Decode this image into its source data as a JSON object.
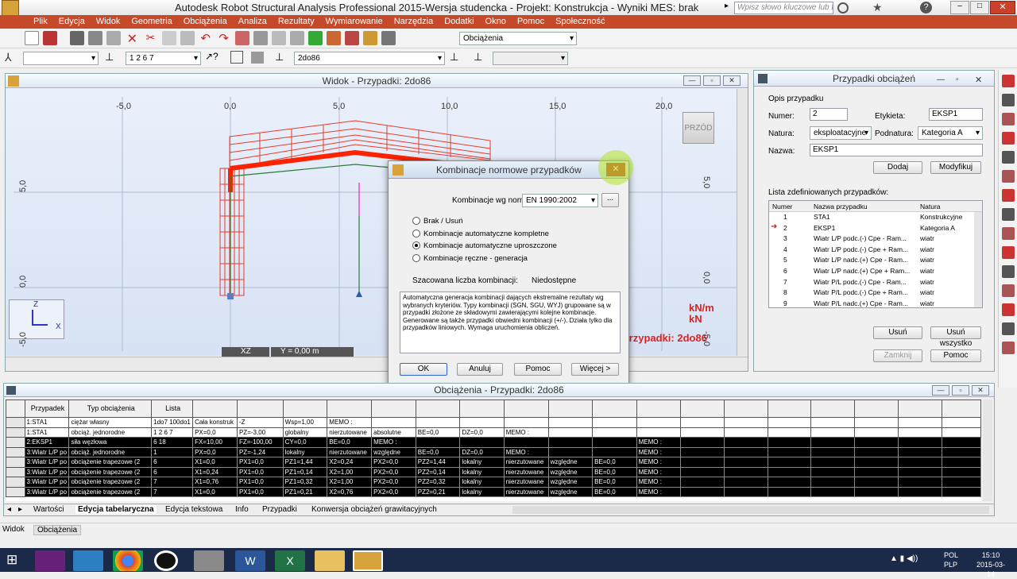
{
  "app": {
    "title": "Autodesk Robot Structural Analysis Professional 2015-Wersja studencka - Projekt: Konstrukcja - Wyniki MES: brak",
    "search_placeholder": "Wpisz słowo kluczowe lub frazę",
    "logo": "PRO"
  },
  "menu": [
    "Plik",
    "Edycja",
    "Widok",
    "Geometria",
    "Obciążenia",
    "Analiza",
    "Rezultaty",
    "Wymiarowanie",
    "Narzędzia",
    "Dodatki",
    "Okno",
    "Pomoc",
    "Społeczność"
  ],
  "toolbar": {
    "loads_combo": "Obciążenia",
    "list_value": "1 2 6 7",
    "case_value": "2do86"
  },
  "view": {
    "title": "Widok - Przypadki: 2do86",
    "badge": "PRZÓD",
    "ruler_top": [
      "-5,0",
      "0,0",
      "5,0",
      "10,0",
      "15,0",
      "20,0"
    ],
    "ruler_side": [
      "5,0",
      "0,0",
      "-5,0"
    ],
    "plane": "XZ",
    "coord": "Y = 0,00 m",
    "units1": "kN/m",
    "units2": "kN",
    "case_label": "Przypadki: 2do86",
    "axis_z": "Z",
    "axis_x": "X"
  },
  "dialog": {
    "title": "Kombinacje normowe przypadków",
    "norm_label": "Kombinacje wg normy:",
    "norm_value": "EN 1990:2002",
    "more_btn": "...",
    "options": [
      "Brak / Usuń",
      "Kombinacje automatyczne kompletne",
      "Kombinacje automatyczne uproszczone",
      "Kombinacje ręczne - generacja"
    ],
    "selected": 2,
    "estimate_label": "Szacowana liczba kombinacji:",
    "estimate_value": "Niedostępne",
    "description": "Automatyczna generacja kombinacji dających ekstremalne rezultaty wg wybranych kryteriów.  Typy kombinacji (SGN, SGU, WYJ) grupowane są w przypadki złożone ze składowymi zawierającymi kolejne kombinacje. Generowane są także przypadki obwiedni kombinacji (+/-). Działa tylko dla przypadków liniowych.  Wymaga uruchomienia obliczeń.",
    "ok": "OK",
    "cancel": "Anuluj",
    "help": "Pomoc",
    "more": "Więcej >"
  },
  "panel": {
    "title": "Przypadki obciążeń",
    "group_label": "Opis przypadku",
    "numer_label": "Numer:",
    "numer_value": "2",
    "etykieta_label": "Etykieta:",
    "etykieta_value": "EKSP1",
    "natura_label": "Natura:",
    "natura_value": "eksploatacyjne",
    "podnatura_label": "Podnatura:",
    "podnatura_value": "Kategoria A",
    "nazwa_label": "Nazwa:",
    "nazwa_value": "EKSP1",
    "add": "Dodaj",
    "modify": "Modyfikuj",
    "list_label": "Lista zdefiniowanych przypadków:",
    "cols": [
      "Numer",
      "Nazwa przypadku",
      "Natura"
    ],
    "rows": [
      [
        "1",
        "STA1",
        "Konstrukcyjne"
      ],
      [
        "2",
        "EKSP1",
        "Kategoria A"
      ],
      [
        "3",
        "Wiatr L/P podc.(-) Cpe - Ram...",
        "wiatr"
      ],
      [
        "4",
        "Wiatr L/P podc.(-) Cpe + Ram...",
        "wiatr"
      ],
      [
        "5",
        "Wiatr L/P nadc.(+) Cpe - Ram...",
        "wiatr"
      ],
      [
        "6",
        "Wiatr L/P nadc.(+) Cpe + Ram...",
        "wiatr"
      ],
      [
        "7",
        "Wiatr P/L podc.(-) Cpe - Ram...",
        "wiatr"
      ],
      [
        "8",
        "Wiatr P/L podc.(-) Cpe + Ram...",
        "wiatr"
      ],
      [
        "9",
        "Wiatr P/L nadc.(+) Cpe - Ram...",
        "wiatr"
      ]
    ],
    "remove": "Usuń",
    "remove_all": "Usuń wszystko",
    "close": "Zamknij",
    "help": "Pomoc"
  },
  "table": {
    "title": "Obciążenia - Przypadki: 2do86",
    "header": [
      "Przypadek",
      "Typ obciążenia",
      "Lista"
    ],
    "rows": [
      [
        "1:STA1",
        "ciężar własny",
        "1do7 100do1",
        "Cała konstruk",
        "-Z",
        "Wsp=1,00",
        "MEMO :",
        "",
        "",
        "",
        "",
        "",
        ""
      ],
      [
        "1:STA1",
        "obciąż. jednorodne",
        "1 2 6 7",
        "PX=0,0",
        "PZ=-3,00",
        "globalny",
        "nierzutowane",
        "absolutne",
        "BE=0,0",
        "DZ=0,0",
        "MEMO :",
        "",
        ""
      ],
      [
        "2:EKSP1",
        "siła węzłowa",
        "6 18",
        "FX=10,00",
        "FZ=-100,00",
        "CY=0,0",
        "BE=0,0",
        "MEMO :",
        "",
        "",
        "",
        "",
        ""
      ],
      [
        "3:Wiatr L/P po",
        "obciąż. jednorodne",
        "1",
        "PX=0,0",
        "PZ=-1,24",
        "lokalny",
        "nierzutowane",
        "względne",
        "BE=0,0",
        "DZ=0,0",
        "MEMO :",
        "",
        ""
      ],
      [
        "3:Wiatr L/P po",
        "obciążenie trapezowe (2",
        "6",
        "X1=0,0",
        "PX1=0,0",
        "PZ1=1,44",
        "X2=0,24",
        "PX2=0,0",
        "PZ2=1,44",
        "lokalny",
        "nierzutowane",
        "względne",
        "BE=0,0"
      ],
      [
        "3:Wiatr L/P po",
        "obciążenie trapezowe (2",
        "6",
        "X1=0,24",
        "PX1=0,0",
        "PZ1=0,14",
        "X2=1,00",
        "PX2=0,0",
        "PZ2=0,14",
        "lokalny",
        "nierzutowane",
        "względne",
        "BE=0,0"
      ],
      [
        "3:Wiatr L/P po",
        "obciążenie trapezowe (2",
        "7",
        "X1=0,76",
        "PX1=0,0",
        "PZ1=0,32",
        "X2=1,00",
        "PX2=0,0",
        "PZ2=0,32",
        "lokalny",
        "nierzutowane",
        "względne",
        "BE=0,0"
      ],
      [
        "3:Wiatr L/P po",
        "obciążenie trapezowe (2",
        "7",
        "X1=0,0",
        "PX1=0,0",
        "PZ1=0,21",
        "X2=0,76",
        "PX2=0,0",
        "PZ2=0,21",
        "lokalny",
        "nierzutowane",
        "względne",
        "BE=0,0"
      ]
    ],
    "memo": "MEMO :",
    "tabs": [
      "Wartości",
      "Edycja tabelaryczna",
      "Edycja tekstowa",
      "Info",
      "Przypadki",
      "Konwersja obciążeń grawitacyjnych"
    ]
  },
  "status": {
    "left": "Widok",
    "right": "Obciążenia"
  },
  "taskbar": {
    "lang1": "POL",
    "lang2": "PLP",
    "time": "15:10",
    "date": "2015-03-14"
  }
}
